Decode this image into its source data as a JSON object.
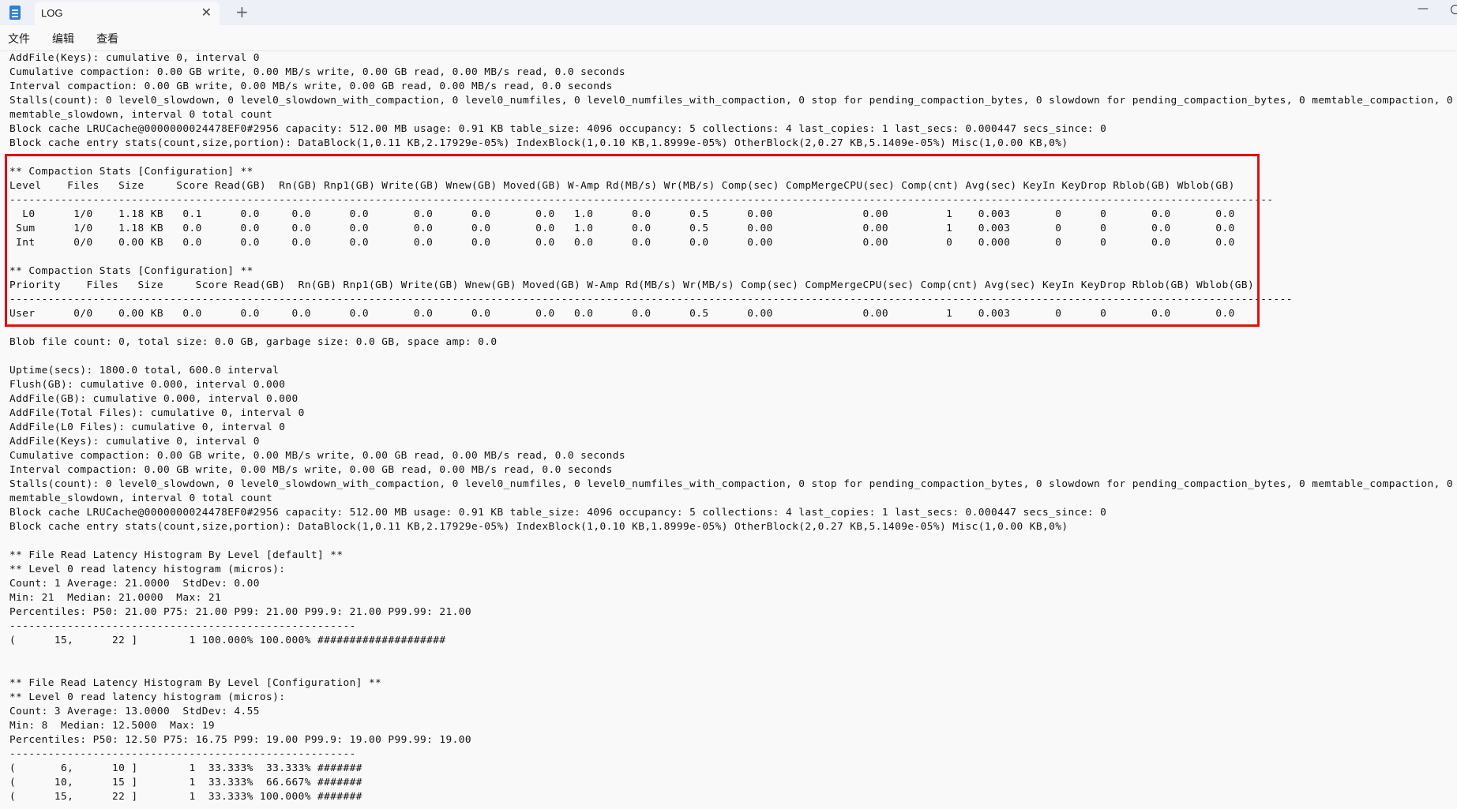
{
  "tab": {
    "title": "LOG",
    "close_glyph": "✕",
    "new_tab_glyph": "+"
  },
  "window": {
    "minimize_glyph": "—"
  },
  "menu": {
    "file": "文件",
    "edit": "编辑",
    "view": "查看"
  },
  "highlight": {
    "color": "#e01010"
  },
  "log_lines": [
    "AddFile(Keys): cumulative 0, interval 0",
    "Cumulative compaction: 0.00 GB write, 0.00 MB/s write, 0.00 GB read, 0.00 MB/s read, 0.0 seconds",
    "Interval compaction: 0.00 GB write, 0.00 MB/s write, 0.00 GB read, 0.00 MB/s read, 0.0 seconds",
    "Stalls(count): 0 level0_slowdown, 0 level0_slowdown_with_compaction, 0 level0_numfiles, 0 level0_numfiles_with_compaction, 0 stop for pending_compaction_bytes, 0 slowdown for pending_compaction_bytes, 0 memtable_compaction, 0",
    "memtable_slowdown, interval 0 total count",
    "Block cache LRUCache@0000000024478EF0#2956 capacity: 512.00 MB usage: 0.91 KB table_size: 4096 occupancy: 5 collections: 4 last_copies: 1 last_secs: 0.000447 secs_since: 0",
    "Block cache entry stats(count,size,portion): DataBlock(1,0.11 KB,2.17929e-05%) IndexBlock(1,0.10 KB,1.8999e-05%) OtherBlock(2,0.27 KB,5.1409e-05%) Misc(1,0.00 KB,0%)",
    "",
    "** Compaction Stats [Configuration] **",
    "Level    Files   Size     Score Read(GB)  Rn(GB) Rnp1(GB) Write(GB) Wnew(GB) Moved(GB) W-Amp Rd(MB/s) Wr(MB/s) Comp(sec) CompMergeCPU(sec) Comp(cnt) Avg(sec) KeyIn KeyDrop Rblob(GB) Wblob(GB)",
    "-----------------------------------------------------------------------------------------------------------------------------------------------------------------------------------------------------",
    "  L0      1/0    1.18 KB   0.1      0.0     0.0      0.0       0.0      0.0       0.0   1.0      0.0      0.5      0.00              0.00         1    0.003       0      0       0.0       0.0",
    " Sum      1/0    1.18 KB   0.0      0.0     0.0      0.0       0.0      0.0       0.0   1.0      0.0      0.5      0.00              0.00         1    0.003       0      0       0.0       0.0",
    " Int      0/0    0.00 KB   0.0      0.0     0.0      0.0       0.0      0.0       0.0   0.0      0.0      0.0      0.00              0.00         0    0.000       0      0       0.0       0.0",
    "",
    "** Compaction Stats [Configuration] **",
    "Priority    Files   Size     Score Read(GB)  Rn(GB) Rnp1(GB) Write(GB) Wnew(GB) Moved(GB) W-Amp Rd(MB/s) Wr(MB/s) Comp(sec) CompMergeCPU(sec) Comp(cnt) Avg(sec) KeyIn KeyDrop Rblob(GB) Wblob(GB)",
    "--------------------------------------------------------------------------------------------------------------------------------------------------------------------------------------------------------",
    "User      0/0    0.00 KB   0.0      0.0     0.0      0.0       0.0      0.0       0.0   0.0      0.0      0.5      0.00              0.00         1    0.003       0      0       0.0       0.0",
    "",
    "Blob file count: 0, total size: 0.0 GB, garbage size: 0.0 GB, space amp: 0.0",
    "",
    "Uptime(secs): 1800.0 total, 600.0 interval",
    "Flush(GB): cumulative 0.000, interval 0.000",
    "AddFile(GB): cumulative 0.000, interval 0.000",
    "AddFile(Total Files): cumulative 0, interval 0",
    "AddFile(L0 Files): cumulative 0, interval 0",
    "AddFile(Keys): cumulative 0, interval 0",
    "Cumulative compaction: 0.00 GB write, 0.00 MB/s write, 0.00 GB read, 0.00 MB/s read, 0.0 seconds",
    "Interval compaction: 0.00 GB write, 0.00 MB/s write, 0.00 GB read, 0.00 MB/s read, 0.0 seconds",
    "Stalls(count): 0 level0_slowdown, 0 level0_slowdown_with_compaction, 0 level0_numfiles, 0 level0_numfiles_with_compaction, 0 stop for pending_compaction_bytes, 0 slowdown for pending_compaction_bytes, 0 memtable_compaction, 0",
    "memtable_slowdown, interval 0 total count",
    "Block cache LRUCache@0000000024478EF0#2956 capacity: 512.00 MB usage: 0.91 KB table_size: 4096 occupancy: 5 collections: 4 last_copies: 1 last_secs: 0.000447 secs_since: 0",
    "Block cache entry stats(count,size,portion): DataBlock(1,0.11 KB,2.17929e-05%) IndexBlock(1,0.10 KB,1.8999e-05%) OtherBlock(2,0.27 KB,5.1409e-05%) Misc(1,0.00 KB,0%)",
    "",
    "** File Read Latency Histogram By Level [default] **",
    "** Level 0 read latency histogram (micros):",
    "Count: 1 Average: 21.0000  StdDev: 0.00",
    "Min: 21  Median: 21.0000  Max: 21",
    "Percentiles: P50: 21.00 P75: 21.00 P99: 21.00 P99.9: 21.00 P99.99: 21.00",
    "------------------------------------------------------",
    "(      15,      22 ]        1 100.000% 100.000% ####################",
    "",
    "",
    "** File Read Latency Histogram By Level [Configuration] **",
    "** Level 0 read latency histogram (micros):",
    "Count: 3 Average: 13.0000  StdDev: 4.55",
    "Min: 8  Median: 12.5000  Max: 19",
    "Percentiles: P50: 12.50 P75: 16.75 P99: 19.00 P99.9: 19.00 P99.99: 19.00",
    "------------------------------------------------------",
    "(       6,      10 ]        1  33.333%  33.333% #######",
    "(      10,      15 ]        1  33.333%  66.667% #######",
    "(      15,      22 ]        1  33.333% 100.000% #######"
  ]
}
